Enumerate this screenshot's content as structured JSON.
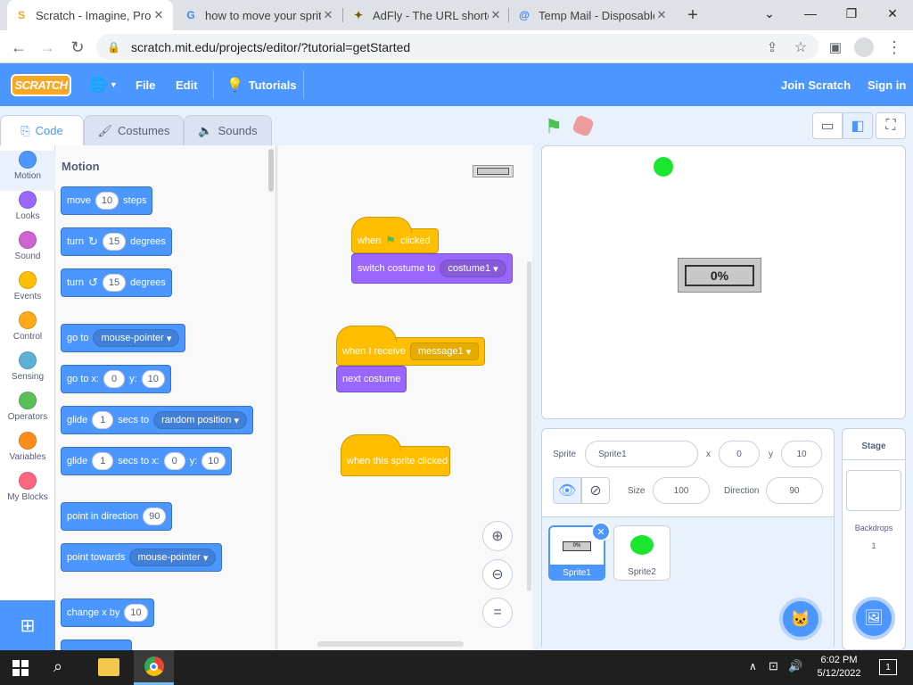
{
  "browser": {
    "tabs": [
      {
        "title": "Scratch - Imagine, Program",
        "icon": "scratch-favicon",
        "icon_glyph": "S",
        "icon_color": "#f9a825"
      },
      {
        "title": "how to move your sprite",
        "icon": "google-favicon",
        "icon_glyph": "G",
        "icon_color": "#4285f4"
      },
      {
        "title": "AdFly - The URL shortener",
        "icon": "adfly-favicon",
        "icon_glyph": "✦",
        "icon_color": "#7a5a00"
      },
      {
        "title": "Temp Mail - Disposable",
        "icon": "tempmail-favicon",
        "icon_glyph": "@",
        "icon_color": "#3b82f6"
      }
    ],
    "url": "scratch.mit.edu/projects/editor/?tutorial=getStarted"
  },
  "menubar": {
    "logo": "SCRATCH",
    "file": "File",
    "edit": "Edit",
    "tutorials": "Tutorials",
    "join": "Join Scratch",
    "signin": "Sign in"
  },
  "editor_tabs": {
    "code": "Code",
    "costumes": "Costumes",
    "sounds": "Sounds"
  },
  "categories": [
    {
      "label": "Motion",
      "color": "#4c97ff"
    },
    {
      "label": "Looks",
      "color": "#9966ff"
    },
    {
      "label": "Sound",
      "color": "#cf63cf"
    },
    {
      "label": "Events",
      "color": "#ffbf00"
    },
    {
      "label": "Control",
      "color": "#ffab19"
    },
    {
      "label": "Sensing",
      "color": "#5cb1d6"
    },
    {
      "label": "Operators",
      "color": "#59c059"
    },
    {
      "label": "Variables",
      "color": "#ff8c1a"
    },
    {
      "label": "My Blocks",
      "color": "#ff6680"
    }
  ],
  "palette": {
    "heading": "Motion",
    "move": {
      "a": "move",
      "n": "10",
      "b": "steps"
    },
    "turn_right": {
      "a": "turn",
      "n": "15",
      "b": "degrees"
    },
    "turn_left": {
      "a": "turn",
      "n": "15",
      "b": "degrees"
    },
    "goto": {
      "a": "go to",
      "d": "mouse-pointer"
    },
    "gotoxy": {
      "a": "go to x:",
      "x": "0",
      "b": "y:",
      "y": "10"
    },
    "glide1": {
      "a": "glide",
      "n": "1",
      "b": "secs to",
      "d": "random position"
    },
    "glide2": {
      "a": "glide",
      "n": "1",
      "b": "secs to x:",
      "x": "0",
      "c": "y:",
      "y": "10"
    },
    "pointdir": {
      "a": "point in direction",
      "n": "90"
    },
    "pointtowards": {
      "a": "point towards",
      "d": "mouse-pointer"
    },
    "changex": {
      "a": "change x by",
      "n": "10"
    }
  },
  "scripts": {
    "s1_when": "when",
    "s1_clicked": "clicked",
    "s1_switch": "switch costume to",
    "s1_costume": "costume1",
    "s2_receive": "when I receive",
    "s2_message": "message1",
    "s2_next": "next costume",
    "s3_when": "when this sprite clicked"
  },
  "stage": {
    "progress_text": "0%"
  },
  "sprite_info": {
    "sprite_label": "Sprite",
    "sprite_name": "Sprite1",
    "x_label": "x",
    "x": "0",
    "y_label": "y",
    "y": "10",
    "size_label": "Size",
    "size": "100",
    "direction_label": "Direction",
    "direction": "90"
  },
  "sprites": [
    {
      "name": "Sprite1",
      "thumb_text": "0%"
    },
    {
      "name": "Sprite2"
    }
  ],
  "stage_panel": {
    "title": "Stage",
    "backdrops_label": "Backdrops",
    "backdrops_count": "1"
  },
  "taskbar": {
    "time": "6:02 PM",
    "date": "5/12/2022",
    "notifications": "1"
  }
}
